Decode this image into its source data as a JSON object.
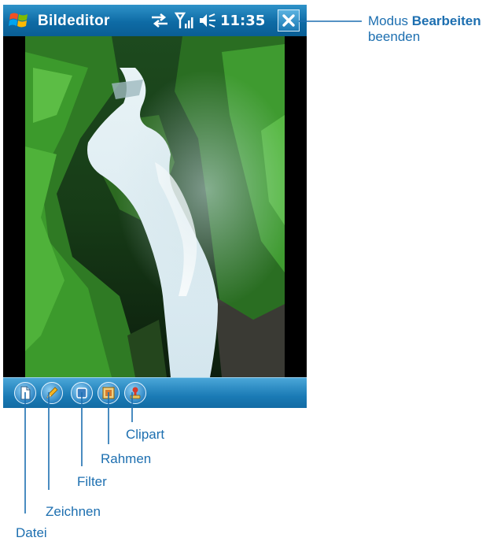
{
  "titlebar": {
    "app_title": "Bildeditor",
    "clock": "11:35"
  },
  "toolbar": {
    "buttons": [
      {
        "name": "Datei",
        "icon": "document-icon"
      },
      {
        "name": "Zeichnen",
        "icon": "pencil-icon"
      },
      {
        "name": "Filter",
        "icon": "filter-icon"
      },
      {
        "name": "Rahmen",
        "icon": "frame-icon"
      },
      {
        "name": "Clipart",
        "icon": "stamp-icon"
      }
    ]
  },
  "annotations": {
    "close_line1_prefix": "Modus ",
    "close_line1_bold": "Bearbeiten",
    "close_line2": "beenden",
    "datei": "Datei",
    "zeichnen": "Zeichnen",
    "filter": "Filter",
    "rahmen": "Rahmen",
    "clipart": "Clipart"
  },
  "colors": {
    "titlebar": "#0e6ba5",
    "toolbar": "#1a7ab5",
    "annotation_text": "#1d6fb0",
    "callout_line": "#1d6fb0"
  }
}
